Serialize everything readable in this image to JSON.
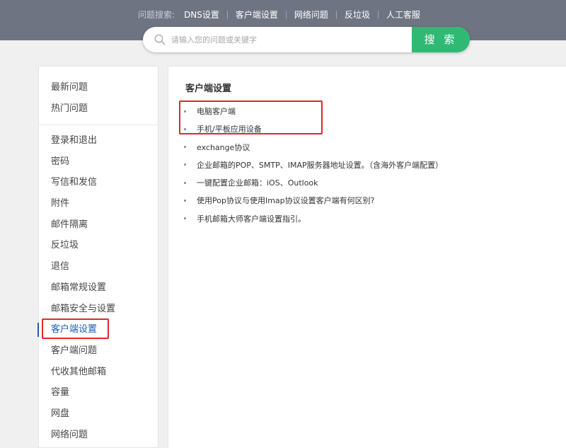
{
  "header": {
    "quick_search_prefix": "问题搜索:",
    "quick_links": [
      "DNS设置",
      "客户端设置",
      "网络问题",
      "反垃圾",
      "人工客服"
    ]
  },
  "search": {
    "placeholder": "请输入您的问题或关键字",
    "button_label": "搜 索",
    "icon": "search-icon"
  },
  "sidebar": {
    "group1": [
      "最新问题",
      "热门问题"
    ],
    "group2": [
      "登录和退出",
      "密码",
      "写信和发信",
      "附件",
      "邮件隔离",
      "反垃圾",
      "退信",
      "邮箱常规设置",
      "邮箱安全与设置",
      "客户端设置",
      "客户端问题",
      "代收其他邮箱",
      "容量",
      "网盘",
      "网络问题"
    ],
    "active": "客户端设置"
  },
  "main": {
    "title": "客户端设置",
    "items": [
      "电脑客户端",
      "手机/平板应用设备",
      "exchange协议",
      "企业邮箱的POP、SMTP、IMAP服务器地址设置。（含海外客户端配置）",
      "一键配置企业邮箱：iOS、Outlook",
      "使用Pop协议与使用Imap协议设置客户端有何区别?",
      "手机邮箱大师客户端设置指引。"
    ]
  },
  "colors": {
    "topbar_bg": "#6f7483",
    "search_button": "#2fb975",
    "active_link": "#1a5fb4",
    "highlight_border": "#e3262b"
  }
}
